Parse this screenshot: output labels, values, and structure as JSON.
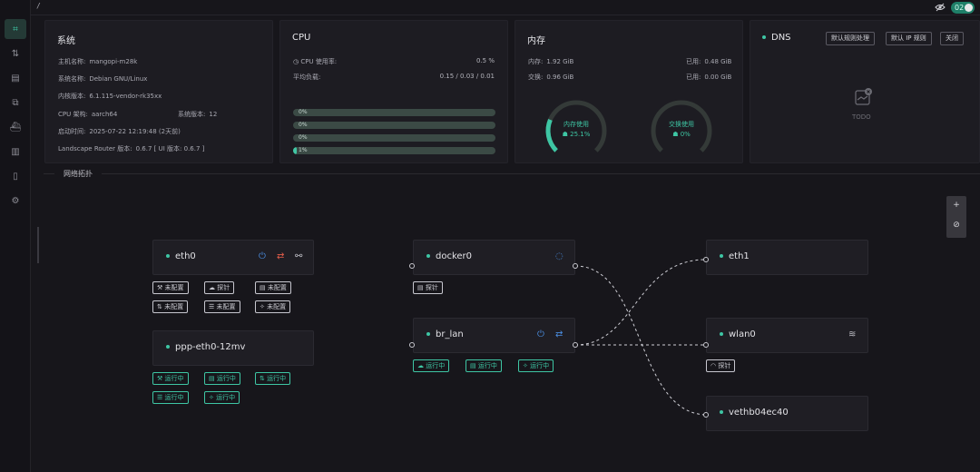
{
  "topbar": {
    "path": "/",
    "badge": "02"
  },
  "sidebar": {
    "items": [
      {
        "icon": "dashboard-icon",
        "glyph": "⌗",
        "active": true
      },
      {
        "icon": "sort-arrows-icon",
        "glyph": "⇅"
      },
      {
        "icon": "storage-icon",
        "glyph": "▤"
      },
      {
        "icon": "network-topology-icon",
        "glyph": "⧉"
      },
      {
        "icon": "docker-icon",
        "glyph": "⛴"
      },
      {
        "icon": "chart-icon",
        "glyph": "▥"
      },
      {
        "icon": "document-icon",
        "glyph": "▯"
      },
      {
        "icon": "settings-icon",
        "glyph": "⚙"
      }
    ]
  },
  "system": {
    "title": "系统",
    "hostname_label": "主机名称:",
    "hostname": "mangopi-m28k",
    "os_label": "系统名称:",
    "os": "Debian GNU/Linux",
    "kernel_label": "内核版本:",
    "kernel": "6.1.115-vendor-rk35xx",
    "arch_label": "CPU 架构:",
    "arch": "aarch64",
    "load_label": "系统版本:",
    "load": "12",
    "boot_label": "启动时间:",
    "boot": "2025-07-22 12:19:48 (2天前)",
    "version_label": "Landscape Router 版本:",
    "version": "0.6.7 [ UI 版本: 0.6.7 ]"
  },
  "cpu": {
    "title": "CPU",
    "usage_label": "CPU 使用率:",
    "usage": "0.5 %",
    "loadavg_label": "平均负载:",
    "loadavg": "0.15 / 0.03 / 0.01",
    "cores": [
      {
        "label": "0%",
        "value": 0
      },
      {
        "label": "0%",
        "value": 0
      },
      {
        "label": "0%",
        "value": 0
      },
      {
        "label": "1%",
        "value": 1
      }
    ]
  },
  "memory": {
    "title": "内存",
    "mem_label": "内存:",
    "mem": "1.92 GiB",
    "used_label": "已用:",
    "used": "0.48 GiB",
    "swap_label": "交换:",
    "swap": "0.96 GiB",
    "swap_used_label": "已用:",
    "swap_used": "0.00 GiB",
    "gauge1_label": "内存使用",
    "gauge1_value": "25.1%",
    "gauge1_pct": 25.1,
    "gauge2_label": "交换使用",
    "gauge2_value": "0%",
    "gauge2_pct": 0
  },
  "dns": {
    "title": "DNS",
    "btn1": "默认规则处理",
    "btn2": "默认 IP 规则",
    "btn3": "关闭",
    "placeholder": "TODO"
  },
  "topology": {
    "title": "网络拓扑",
    "nodes": {
      "eth0": {
        "name": "eth0",
        "chips": [
          "未配置",
          "探针",
          "未配置",
          "未配置",
          "未配置",
          "未配置"
        ]
      },
      "ppp": {
        "name": "ppp-eth0-12mv",
        "chips": [
          "运行中",
          "运行中",
          "运行中",
          "运行中",
          "运行中"
        ]
      },
      "docker0": {
        "name": "docker0",
        "chips": [
          "探针"
        ]
      },
      "br_lan": {
        "name": "br_lan",
        "chips": [
          "运行中",
          "运行中",
          "运行中"
        ]
      },
      "eth1": {
        "name": "eth1"
      },
      "wlan0": {
        "name": "wlan0",
        "chips": [
          "探针"
        ]
      },
      "veth": {
        "name": "vethb04ec40"
      }
    },
    "colors": {
      "accent": "#3ec6a4",
      "power": "#4a8de0",
      "warn": "#e35d4a"
    }
  }
}
